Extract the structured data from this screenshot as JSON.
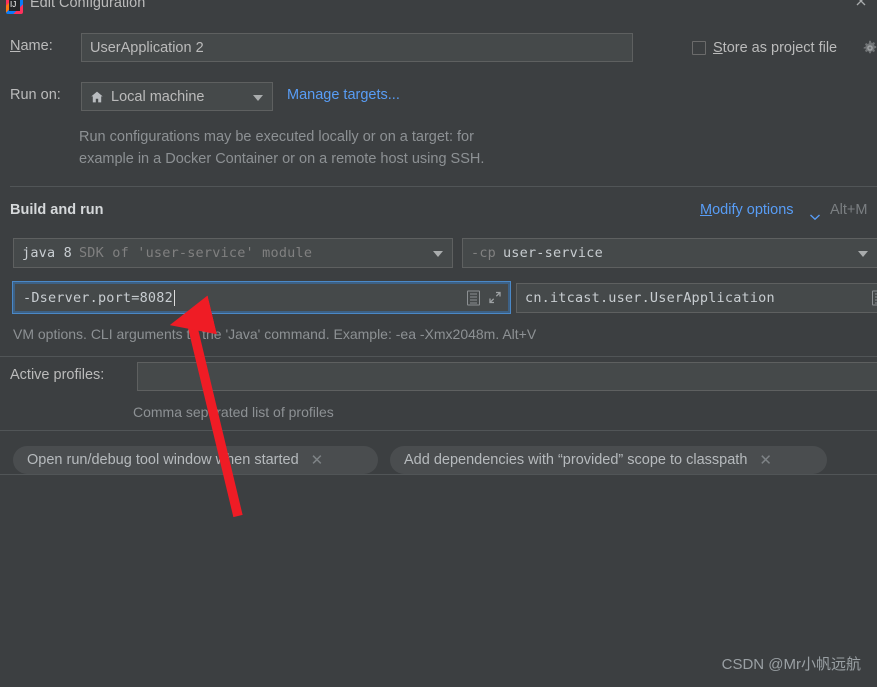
{
  "window": {
    "title": "Edit Configuration",
    "app_icon": "intellij-idea-icon",
    "close_icon": "close-icon"
  },
  "form": {
    "name_label": "Name:",
    "name_label_mnemonic": "N",
    "name_value": "UserApplication 2",
    "store_as_project_file": {
      "label": "Store as project file",
      "mnemonic": "S",
      "checked": false,
      "gear_icon": "gear-icon"
    },
    "run_on_label": "Run on:",
    "run_on_value": "Local machine",
    "run_on_icon": "home-icon",
    "manage_targets_link": "Manage targets...",
    "description_line1": "Run configurations may be executed locally or on a target: for",
    "description_line2": "example in a Docker Container or on a remote host using SSH."
  },
  "build_and_run": {
    "section_title": "Build and run",
    "modify_options_link": "Modify options",
    "modify_options_mnemonic": "M",
    "modify_options_chevron": "chevron-down-icon",
    "modify_options_shortcut": "Alt+M",
    "jdk": {
      "primary": "java 8",
      "secondary": "SDK of 'user-service' module"
    },
    "classpath": {
      "flag": "-cp",
      "module": "user-service"
    },
    "vm_options": {
      "value": "-Dserver.port=8082",
      "focused": true,
      "expand_icon": "expand-icon",
      "list_icon": "document-list-icon"
    },
    "main_class": {
      "value": "cn.itcast.user.UserApplication",
      "list_icon": "document-list-icon"
    },
    "vm_options_hint": "VM options. CLI arguments to the 'Java' command. Example: -ea -Xmx2048m. Alt+V"
  },
  "active_profiles": {
    "label": "Active profiles:",
    "value": "",
    "hint": "Comma separated list of profiles"
  },
  "option_chips": [
    {
      "label": "Open run/debug tool window when started",
      "remove_icon": "close-icon"
    },
    {
      "label": "Add dependencies with “provided” scope to classpath",
      "remove_icon": "close-icon"
    }
  ],
  "annotation": {
    "type": "red-arrow",
    "color": "#ef1c25",
    "points_at": "vm-options-input"
  },
  "watermark": "CSDN @Mr小帆远航",
  "colors": {
    "background": "#3c3f41",
    "field_background": "#45494a",
    "link": "#589df6",
    "focus_border": "#4a88c7",
    "text": "#bbbbbb",
    "muted_text": "#8d9194",
    "annotation_red": "#ef1c25"
  }
}
